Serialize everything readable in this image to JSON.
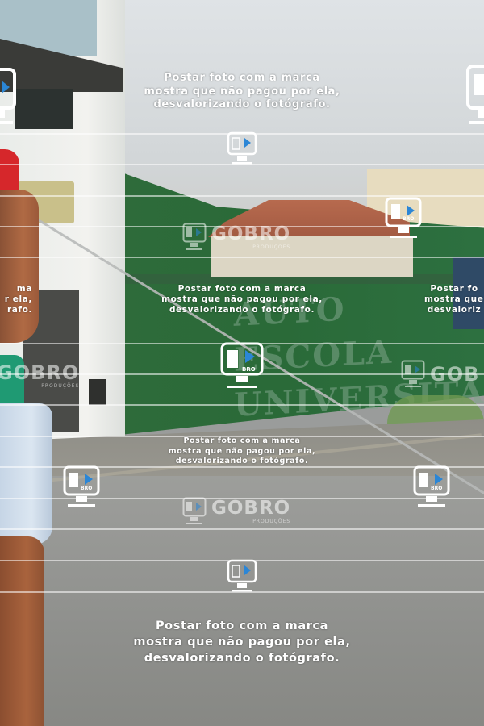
{
  "watermark": {
    "notice_lines": [
      "Postar foto com a marca",
      "mostra que não pagou por ela,",
      "desvalorizando o fotógrafo."
    ],
    "notice_lines_cropped_right": [
      "Postar fo",
      "mostra que n",
      "desvaloriz"
    ],
    "notice_lines_cropped_left": [
      "ma",
      "r ela,",
      "rafo."
    ],
    "brand": "GOBRO",
    "brand_sub": "PRODUÇÕES",
    "camera_label": "BRO",
    "brand_cropped_left": "GOBRO",
    "brand_cropped_right": "GOB"
  },
  "scene": {
    "wall_text": [
      "AUTO  ESCOLA",
      "UNIVERSITÁRIA"
    ]
  },
  "colors": {
    "camera_lens": "#2b86d6",
    "camera_outline": "#ffffff",
    "wall_green": "#2a6a38",
    "shirt_red": "#d6272b"
  },
  "icons": [
    "action-camera-icon",
    "gobro-logo"
  ]
}
